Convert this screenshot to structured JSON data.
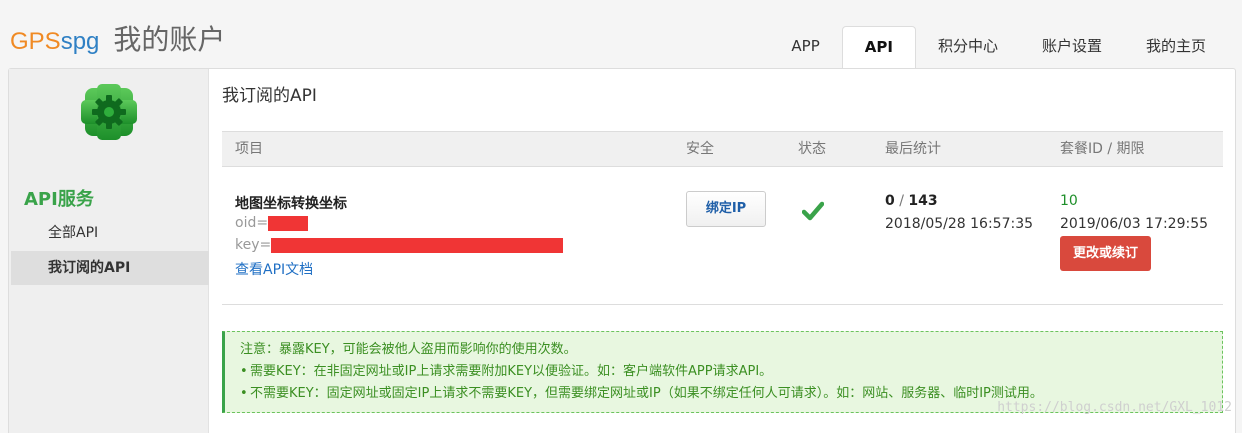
{
  "logo": {
    "gps": "GPS",
    "spg": "spg",
    "title": "我的账户"
  },
  "tabs": [
    {
      "label": "APP",
      "active": false
    },
    {
      "label": "API",
      "active": true
    },
    {
      "label": "积分中心",
      "active": false
    },
    {
      "label": "账户设置",
      "active": false
    },
    {
      "label": "我的主页",
      "active": false
    }
  ],
  "sidebar": {
    "icon": "gear-icon",
    "heading": "API服务",
    "items": [
      {
        "label": "全部API",
        "active": false
      },
      {
        "label": "我订阅的API",
        "active": true
      }
    ]
  },
  "main": {
    "title": "我订阅的API",
    "table": {
      "headers": [
        "项目",
        "安全",
        "状态",
        "最后统计",
        "套餐ID / 期限"
      ],
      "row": {
        "name": "地图坐标转换坐标",
        "oid_label": "oid=",
        "key_label": "key=",
        "doc_link": "查看API文档",
        "bind_button": "绑定IP",
        "status_icon": "check-icon",
        "count_used": "0",
        "count_sep": " / ",
        "count_total": "143",
        "last_time": "2018/05/28 16:57:35",
        "package_id": "10",
        "expire_time": "2019/06/03 17:29:55",
        "renew_button": "更改或续订"
      }
    },
    "notice": {
      "title": "注意：暴露KEY，可能会被他人盗用而影响你的使用次数。",
      "items": [
        "需要KEY：在非固定网址或IP上请求需要附加KEY以便验证。如：客户端软件APP请求API。",
        "不需要KEY：固定网址或固定IP上请求不需要KEY，但需要绑定网址或IP（如果不绑定任何人可请求）。如：网站、服务器、临时IP测试用。"
      ]
    }
  },
  "watermark": "https://blog.csdn.net/GXL_1012",
  "colors": {
    "accent_green": "#3aa34a",
    "red": "#d9493d",
    "link": "#1f6fc4",
    "mask": "#f03535"
  }
}
